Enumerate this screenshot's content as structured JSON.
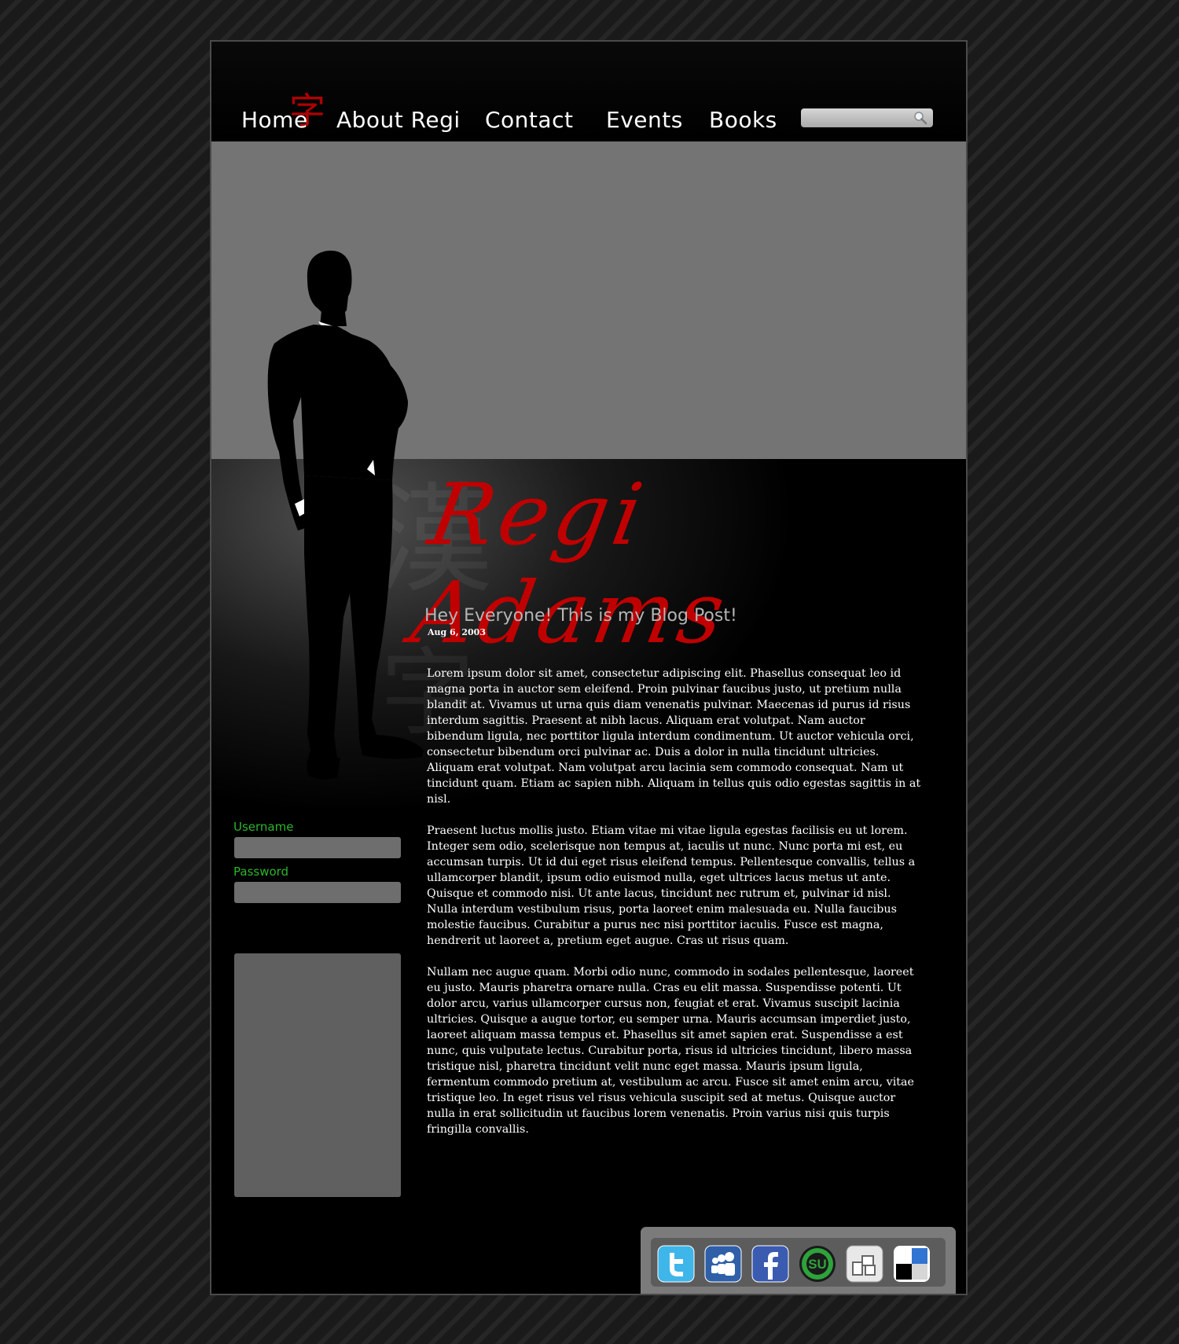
{
  "nav": {
    "items": [
      {
        "label": "Home"
      },
      {
        "label": "About Regi"
      },
      {
        "label": "Contact"
      },
      {
        "label": "Events"
      },
      {
        "label": "Books"
      }
    ],
    "home_glyph": "字"
  },
  "search": {
    "placeholder": "",
    "icon": "search-icon"
  },
  "brand": {
    "logo_text": "Regi Adams",
    "watermark_glyph_1": "漢",
    "watermark_glyph_2": "字"
  },
  "post": {
    "title": "Hey Everyone! This is my Blog Post!",
    "date": "Aug 6, 2003",
    "paragraphs": [
      "Lorem ipsum dolor sit amet, consectetur adipiscing elit. Phasellus consequat leo id magna porta in auctor sem eleifend. Proin pulvinar faucibus justo, ut pretium nulla blandit at. Vivamus ut urna quis diam venenatis pulvinar. Maecenas id purus id risus interdum sagittis. Praesent at nibh lacus. Aliquam erat volutpat. Nam auctor bibendum ligula, nec porttitor ligula interdum condimentum. Ut auctor vehicula orci, consectetur bibendum orci pulvinar ac. Duis a dolor in nulla tincidunt ultricies. Aliquam erat volutpat. Nam volutpat arcu lacinia sem commodo consequat. Nam ut tincidunt quam. Etiam ac sapien nibh. Aliquam in tellus quis odio egestas sagittis in at nisl.",
      "Praesent luctus mollis justo. Etiam vitae mi vitae ligula egestas facilisis eu ut lorem. Integer sem odio, scelerisque non tempus at, iaculis ut nunc. Nunc porta mi est, eu accumsan turpis. Ut id dui eget risus eleifend tempus. Pellentesque convallis, tellus a ullamcorper blandit, ipsum odio euismod nulla, eget ultrices lacus metus ut ante. Quisque et commodo nisi. Ut ante lacus, tincidunt nec rutrum et, pulvinar id nisl. Nulla interdum vestibulum risus, porta laoreet enim malesuada eu. Nulla faucibus molestie faucibus. Curabitur a purus nec nisi porttitor iaculis. Fusce est magna, hendrerit ut laoreet a, pretium eget augue. Cras ut risus quam.",
      "Nullam nec augue quam. Morbi odio nunc, commodo in sodales pellentesque, laoreet eu justo. Mauris pharetra ornare nulla. Cras eu elit massa. Suspendisse potenti. Ut dolor arcu, varius ullamcorper cursus non, feugiat et erat. Vivamus suscipit lacinia ultricies. Quisque a augue tortor, eu semper urna. Mauris accumsan imperdiet justo, laoreet aliquam massa tempus et. Phasellus sit amet sapien erat. Suspendisse a est nunc, quis vulputate lectus. Curabitur porta, risus id ultricies tincidunt, libero massa tristique nisl, pharetra tincidunt velit nunc eget massa. Mauris ipsum ligula, fermentum commodo pretium at, vestibulum ac arcu. Fusce sit amet enim arcu, vitae tristique leo. In eget risus vel risus vehicula suscipit sed at metus. Quisque auctor nulla in erat sollicitudin ut faucibus lorem venenatis. Proin varius nisi quis turpis fringilla convallis."
    ]
  },
  "login": {
    "username_label": "Username",
    "password_label": "Password",
    "username_value": "",
    "password_value": ""
  },
  "social": [
    "twitter-icon",
    "myspace-icon",
    "facebook-icon",
    "stumbleupon-icon",
    "digg-icon",
    "delicious-icon"
  ],
  "colors": {
    "accent_red": "#c00000",
    "label_green": "#2db52d",
    "hero_gray": "#747474"
  }
}
